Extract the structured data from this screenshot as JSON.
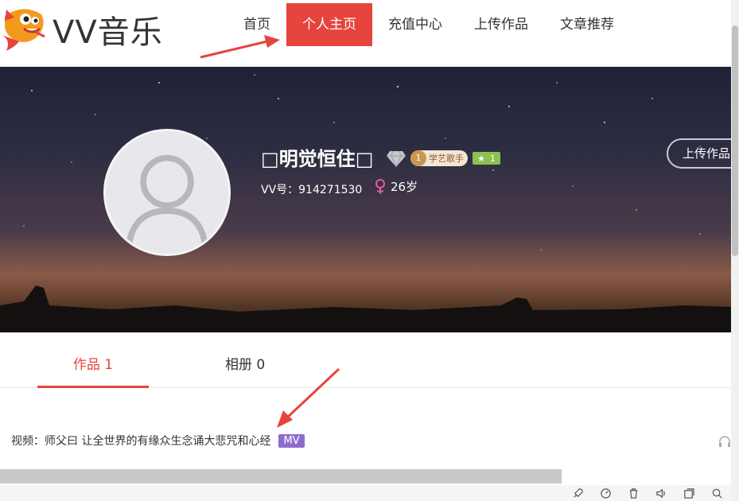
{
  "header": {
    "logo_text": "VV音乐",
    "nav": [
      {
        "label": "首页",
        "active": false
      },
      {
        "label": "个人主页",
        "active": true
      },
      {
        "label": "充值中心",
        "active": false
      },
      {
        "label": "上传作品",
        "active": false
      },
      {
        "label": "文章推荐",
        "active": false
      }
    ]
  },
  "profile": {
    "username": "明觉恒住",
    "level": {
      "number": "1",
      "title": "学艺歌手"
    },
    "star": "1",
    "vv_id": "VV号：914271530",
    "age": "26岁",
    "upload_button": "上传作品"
  },
  "tabs": [
    {
      "label": "作品 1",
      "active": true
    },
    {
      "label": "相册 0",
      "active": false
    }
  ],
  "works": [
    {
      "title": "视频：师父曰 让全世界的有缘众生念诵大悲咒和心经",
      "tag": "MV"
    }
  ],
  "colors": {
    "accent": "#e5453d",
    "mv_tag": "#8e6ccf",
    "star_badge": "#8cc152"
  }
}
